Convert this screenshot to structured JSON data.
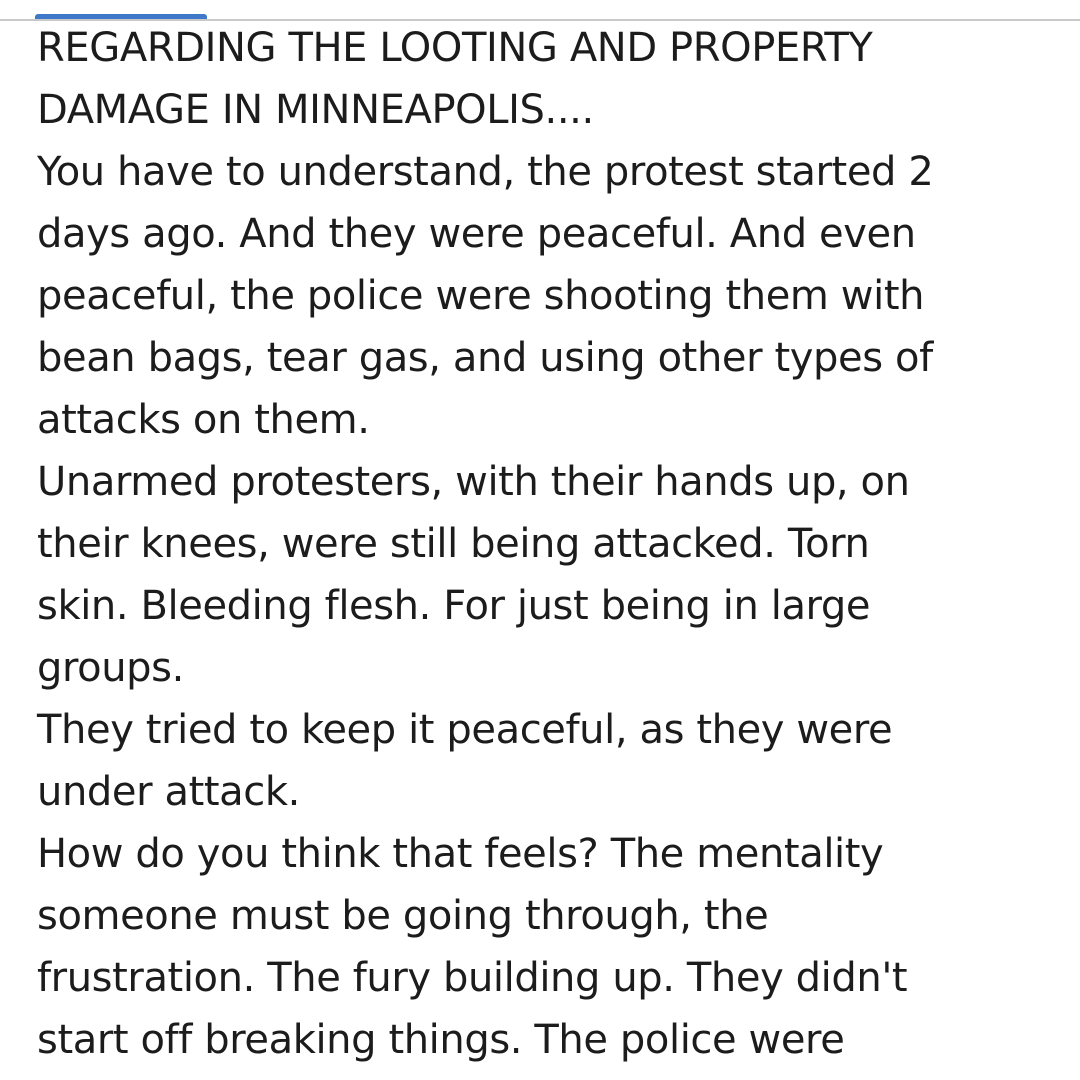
{
  "post": {
    "lines": [
      "REGARDING THE LOOTING AND PROPERTY",
      "DAMAGE IN MINNEAPOLIS....",
      "You have to understand, the protest started 2",
      "days ago. And they were peaceful. And even",
      "peaceful, the police were shooting them with",
      "bean bags, tear gas, and using other types of",
      "attacks on them.",
      "Unarmed protesters, with their hands up, on",
      "their knees, were still being attacked. Torn",
      "skin. Bleeding flesh. For just being in large",
      "groups.",
      "They tried to keep it peaceful, as they were",
      "under attack.",
      "How do you think that feels? The mentality",
      "someone must be going through, the",
      "frustration. The fury building up. They didn't",
      "start off breaking things. The police were"
    ]
  },
  "colors": {
    "text": "#1c1c1c",
    "accent_tab": "#3f78c8",
    "divider": "#c9c9c9",
    "background": "#ffffff"
  }
}
